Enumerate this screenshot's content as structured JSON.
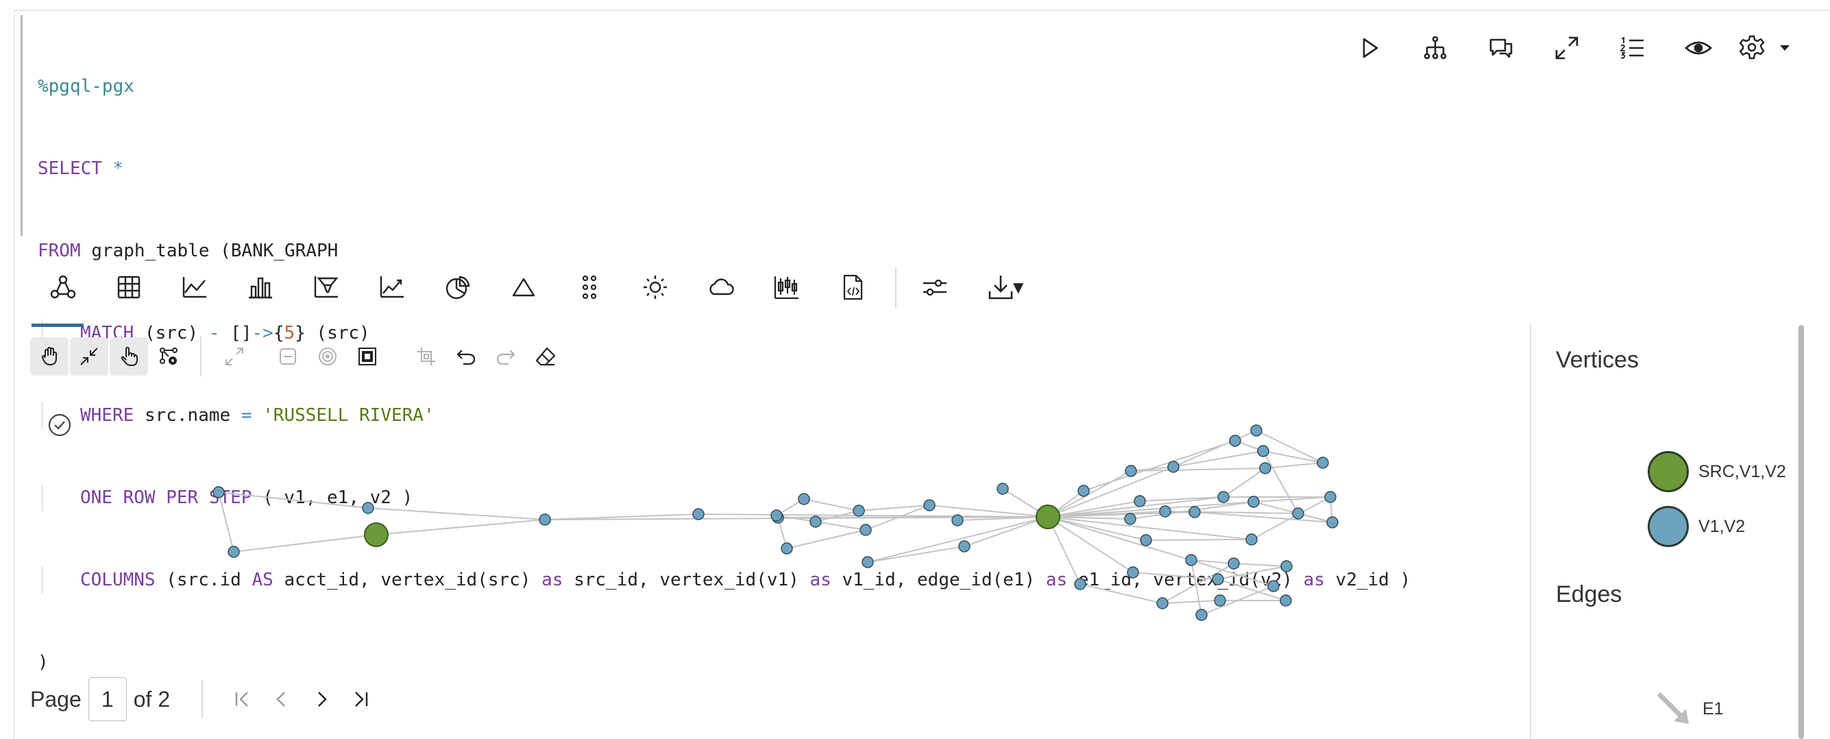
{
  "code": {
    "interpreter": "%pgql-pgx",
    "line1_kw": "SELECT",
    "line1_op": "*",
    "line2_kw": "FROM",
    "line2_rest": "graph_table (BANK_GRAPH",
    "line3_kw": "MATCH",
    "line3_a": "(src)",
    "line3_op1": "-",
    "line3_b": "[]",
    "line3_op2": "->",
    "line3_c": "{",
    "line3_num": "5",
    "line3_d": "} (src)",
    "line4_kw": "WHERE",
    "line4_a": "src.name",
    "line4_op": "=",
    "line4_str": "'RUSSELL RIVERA'",
    "line5_kw": "ONE ROW PER STEP",
    "line5_rest": "( v1, e1, v2 )",
    "line6_kw": "COLUMNS",
    "line6_a": "(src.id",
    "line6_as1": "AS",
    "line6_b": "acct_id, vertex_id(src)",
    "line6_as2": "as",
    "line6_c": "src_id, vertex_id(v1)",
    "line6_as3": "as",
    "line6_d": "v1_id, edge_id(e1)",
    "line6_as4": "as",
    "line6_e": "e1_id, vertex_id(v2)",
    "line6_as5": "as",
    "line6_f": "v2_id )",
    "line7": ")"
  },
  "paragraph_toolbar": [
    "play-icon",
    "hierarchy-icon",
    "comments-icon",
    "expand-icon",
    "numbered-list-icon",
    "eye-icon",
    "gear-icon"
  ],
  "viz_tabs": [
    "graph-icon",
    "table-icon",
    "line-chart-icon",
    "bar-chart-icon",
    "funnel-chart-icon",
    "trend-chart-icon",
    "pie-chart-icon",
    "triangle-chart-icon",
    "dots-grid-icon",
    "sunburst-icon",
    "cloud-icon",
    "candlestick-icon",
    "code-file-icon",
    "settings-sliders-icon",
    "download-icon"
  ],
  "graph_tools": [
    "pan-hand-icon",
    "collapse-icon",
    "pointer-hand-icon",
    "network-settings-icon",
    "fit-icon",
    "minus-icon",
    "target-icon",
    "frame-icon",
    "crop-icon",
    "undo-icon",
    "redo-icon",
    "eraser-icon"
  ],
  "pager": {
    "label": "Page",
    "current": "1",
    "of_text": "of 2"
  },
  "legend": {
    "vertices_title": "Vertices",
    "vertex_items": [
      {
        "label": "SRC,V1,V2",
        "color": "#6b9a3a"
      },
      {
        "label": "V1,V2",
        "color": "#6ea3bf"
      }
    ],
    "edges_title": "Edges",
    "edge_items": [
      {
        "label": "E1",
        "color": "#bdbdbd"
      }
    ]
  },
  "colors": {
    "src_node": "#6b9a3a",
    "node": "#6ea3bf",
    "edge": "#c4c4c4",
    "tab_underline": "#2f6f9a"
  }
}
